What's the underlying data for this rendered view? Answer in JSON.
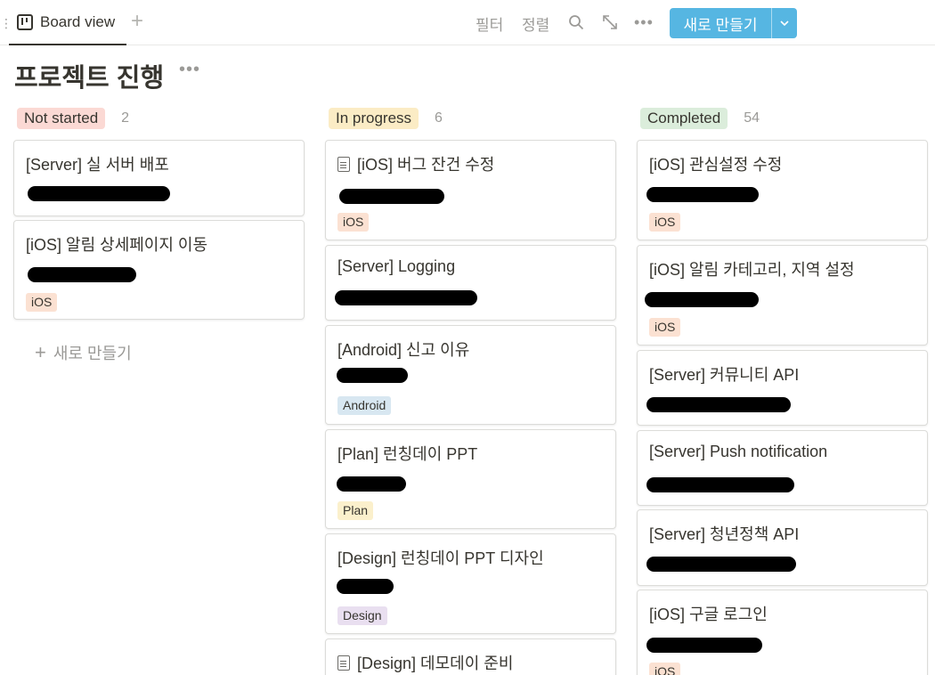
{
  "toolbar": {
    "view_tab_label": "Board view",
    "add_view": "+",
    "filter_label": "필터",
    "sort_label": "정렬",
    "more_label": "•••",
    "new_button_label": "새로 만들기",
    "new_button_caret": "⌄"
  },
  "page": {
    "title": "프로젝트 진행",
    "title_more": "•••"
  },
  "colors": {
    "accent": "#56b6e2",
    "not_started": "#fbd9d4",
    "in_progress": "#fbecc5",
    "completed": "#dbeddb",
    "tag_ios": "#fbe1d2",
    "tag_android": "#d8e7f1",
    "tag_plan": "#fbf0cc",
    "tag_design": "#e9dff0"
  },
  "columns": [
    {
      "status": "Not started",
      "count": "2",
      "new_card_label": "새로 만들기",
      "cards": [
        {
          "title": "[Server] 실 서버 배포"
        },
        {
          "title": "[iOS] 알림 상세페이지 이동",
          "tag": "iOS"
        }
      ]
    },
    {
      "status": "In progress",
      "count": "6",
      "cards": [
        {
          "title": "[iOS] 버그 잔건 수정",
          "tag": "iOS"
        },
        {
          "title": "[Server] Logging"
        },
        {
          "title": "[Android] 신고 이유",
          "tag": "Android"
        },
        {
          "title": "[Plan] 런칭데이 PPT",
          "tag": "Plan"
        },
        {
          "title": "[Design] 런칭데이 PPT 디자인",
          "tag": "Design"
        },
        {
          "title": "[Design] 데모데이 준비"
        }
      ]
    },
    {
      "status": "Completed",
      "count": "54",
      "cards": [
        {
          "title": "[iOS] 관심설정 수정",
          "tag": "iOS"
        },
        {
          "title": "[iOS] 알림 카테고리, 지역 설정",
          "tag": "iOS"
        },
        {
          "title": "[Server] 커뮤니티 API"
        },
        {
          "title": "[Server] Push notification"
        },
        {
          "title": "[Server] 청년정책 API"
        },
        {
          "title": "[iOS] 구글 로그인",
          "tag": "iOS"
        }
      ]
    }
  ]
}
